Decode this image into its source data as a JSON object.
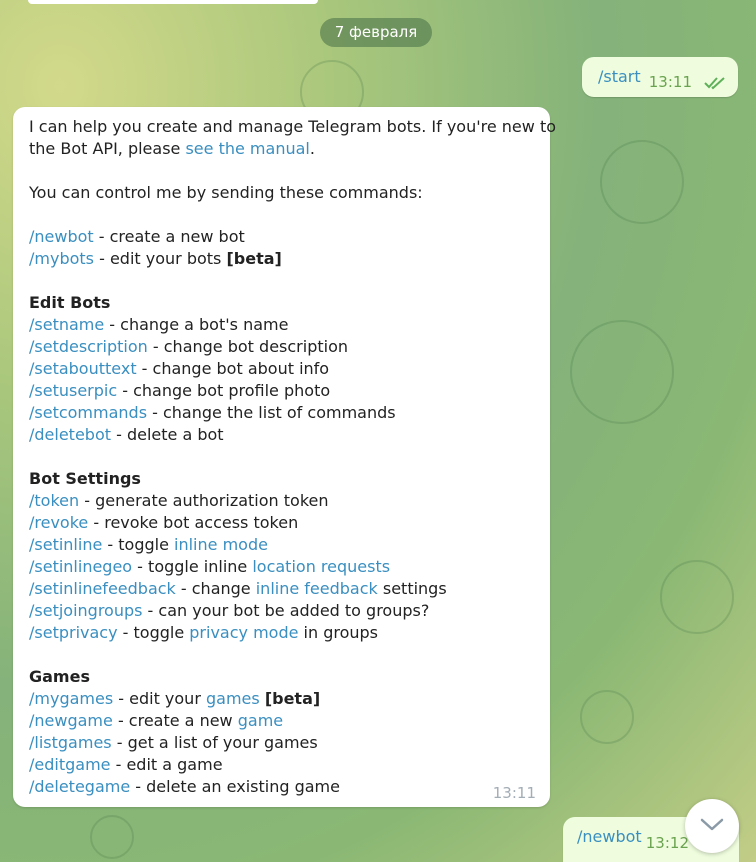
{
  "date_separator": "7 февраля",
  "outgoing": [
    {
      "text": "/start",
      "time": "13:11",
      "read_checks": "double-check-icon"
    },
    {
      "text": "/newbot",
      "time": "13:12"
    }
  ],
  "bot_message": {
    "intro_1": "I can help you create and manage Telegram bots. If you're new to",
    "intro_2a": "the Bot API, please ",
    "intro_2_link": "see the manual",
    "intro_2b": ".",
    "control": "You can control me by sending these commands:",
    "basic": [
      {
        "cmd": "/newbot",
        "desc": " - create a new bot"
      },
      {
        "cmd": "/mybots",
        "desc": " - edit your bots ",
        "bold": "[beta]"
      }
    ],
    "edit_heading": "Edit Bots",
    "edit": [
      {
        "cmd": "/setname",
        "desc": " - change a bot's name"
      },
      {
        "cmd": "/setdescription",
        "desc": " - change bot description"
      },
      {
        "cmd": "/setabouttext",
        "desc": " - change bot about info"
      },
      {
        "cmd": "/setuserpic",
        "desc": " - change bot profile photo"
      },
      {
        "cmd": "/setcommands",
        "desc": " - change the list of commands"
      },
      {
        "cmd": "/deletebot",
        "desc": " - delete a bot"
      }
    ],
    "settings_heading": "Bot Settings",
    "settings": {
      "token": {
        "cmd": "/token",
        "desc": " - generate authorization token"
      },
      "revoke": {
        "cmd": "/revoke",
        "desc": " - revoke bot access token"
      },
      "setinline": {
        "cmd": "/setinline",
        "desc": " - toggle ",
        "link": "inline mode"
      },
      "setinlinegeo": {
        "cmd": "/setinlinegeo",
        "desc": " - toggle inline ",
        "link": "location requests"
      },
      "setinlinefeedback": {
        "cmd": "/setinlinefeedback",
        "desc": " - change ",
        "link": "inline feedback",
        "tail": " settings"
      },
      "setjoingroups": {
        "cmd": "/setjoingroups",
        "desc": " - can your bot be added to groups?"
      },
      "setprivacy": {
        "cmd": "/setprivacy",
        "desc": " - toggle ",
        "link": "privacy mode",
        "tail": " in groups"
      }
    },
    "games_heading": "Games",
    "games": {
      "mygames": {
        "cmd": "/mygames",
        "desc": " - edit your ",
        "link": "games",
        "bold": "[beta]"
      },
      "newgame": {
        "cmd": "/newgame",
        "desc": " - create a new ",
        "link": "game"
      },
      "listgames": {
        "cmd": "/listgames",
        "desc": " - get a list of your games"
      },
      "editgame": {
        "cmd": "/editgame",
        "desc": " - edit a game"
      },
      "deletegame": {
        "cmd": "/deletegame",
        "desc": " - delete an existing game"
      }
    },
    "time": "13:11"
  },
  "scroll_button_icon": "chevron-down-icon",
  "colors": {
    "link": "#3a8fc0",
    "outgoing_bg": "#effdde",
    "check": "#5fb05a"
  }
}
